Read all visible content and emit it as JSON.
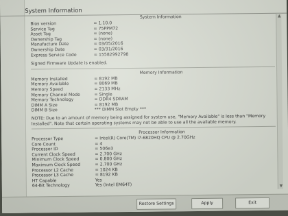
{
  "window": {
    "title": "System Information"
  },
  "sections": {
    "system": {
      "header": "System Information",
      "rows": [
        {
          "label": "Bios version",
          "value": "= 1.10.0"
        },
        {
          "label": "Service Tag",
          "value": "= 75PPM72"
        },
        {
          "label": "Asset Tag",
          "value": "= (none)"
        },
        {
          "label": "Ownership Tag",
          "value": "= (none)"
        },
        {
          "label": "Manufacture Date",
          "value": "= 03/05/2016"
        },
        {
          "label": "Ownership Date",
          "value": "= 03/31/2016"
        },
        {
          "label": "Express Service Code",
          "value": "= 15582992798"
        }
      ],
      "note": "Signed Firmware Update is enabled."
    },
    "memory": {
      "header": "Memory Information",
      "rows": [
        {
          "label": "Memory Installed",
          "value": "= 8192 MB"
        },
        {
          "label": "Memory Available",
          "value": "= 8069 MB"
        },
        {
          "label": "Memory Speed",
          "value": "= 2133 MHz"
        },
        {
          "label": "Memory Channel Mode",
          "value": "= Single"
        },
        {
          "label": "Memory Technology",
          "value": "= DDR4 SDRAM"
        },
        {
          "label": "DIMM A Size",
          "value": "= 8192 MB"
        },
        {
          "label": "DIMM B Size",
          "value": "*** DIMM Slot Empty ***"
        }
      ],
      "note": "NOTE: Due to an amount of memory being assigned for system use, \"Memory Available\" is less than \"Memory Installed\". Note that certain operating systems may not be able to use all the available memory."
    },
    "processor": {
      "header": "Processor Information",
      "rows": [
        {
          "label": "Processor Type",
          "value": "= Intel(R) Core(TM) i7-6820HQ CPU @ 2.70GHz"
        },
        {
          "label": "Core Count",
          "value": "= 4"
        },
        {
          "label": "Processor ID",
          "value": "= 506e3"
        },
        {
          "label": "Current Clock Speed",
          "value": "= 2.700 GHz"
        },
        {
          "label": "Minimum Clock Speed",
          "value": "= 0.800 GHz"
        },
        {
          "label": "Maximum Clock Speed",
          "value": "= 2.700 GHz"
        },
        {
          "label": "Processor L2 Cache",
          "value": "= 1024 KB"
        },
        {
          "label": "Processor L3 Cache",
          "value": "= 8192 KB"
        },
        {
          "label": "HT Capable",
          "value": "Yes"
        },
        {
          "label": "64-Bit Technology",
          "value": "Yes (Intel EM64T)"
        }
      ]
    }
  },
  "buttons": {
    "restore": "Restore Settings",
    "apply": "Apply",
    "exit": "Exit"
  }
}
